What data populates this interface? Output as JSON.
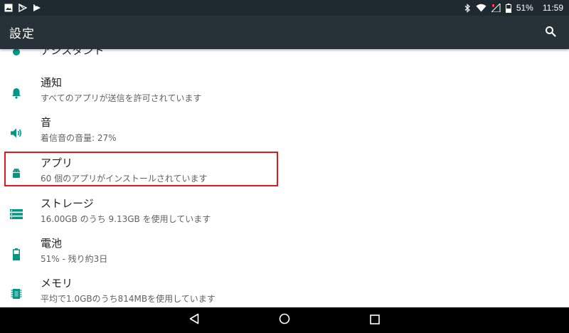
{
  "status_bar": {
    "left_icons": [
      "image-icon",
      "play-store-icon",
      "play-movies-icon"
    ],
    "right_icons": [
      "bluetooth-icon",
      "wifi-icon",
      "cell-signal-icon",
      "battery-icon"
    ],
    "battery_percent": "51%",
    "time": "11:59"
  },
  "toolbar": {
    "title": "設定",
    "search_icon": "search-icon"
  },
  "accent_color": "#009688",
  "highlight_color": "#e0191d",
  "partial_item": {
    "title": "アシスタント"
  },
  "settings": [
    {
      "id": "notifications",
      "icon": "bell-icon",
      "title": "通知",
      "summary": "すべてのアプリが送信を許可されています"
    },
    {
      "id": "sound",
      "icon": "volume-icon",
      "title": "音",
      "summary": "着信音の音量: 27%"
    },
    {
      "id": "apps",
      "icon": "android-icon",
      "title": "アプリ",
      "summary": "60 個のアプリがインストールされています"
    },
    {
      "id": "storage",
      "icon": "storage-icon",
      "title": "ストレージ",
      "summary": "16.00GB のうち 9.13GB を使用しています"
    },
    {
      "id": "battery",
      "icon": "battery-icon",
      "title": "電池",
      "summary": "51% - 残り約3日"
    },
    {
      "id": "memory",
      "icon": "memory-icon",
      "title": "メモリ",
      "summary": "平均で1.0GBのうち814MBを使用しています"
    }
  ],
  "nav_bar": {
    "back_icon": "back-icon",
    "home_icon": "home-icon",
    "recents_icon": "recents-icon"
  }
}
